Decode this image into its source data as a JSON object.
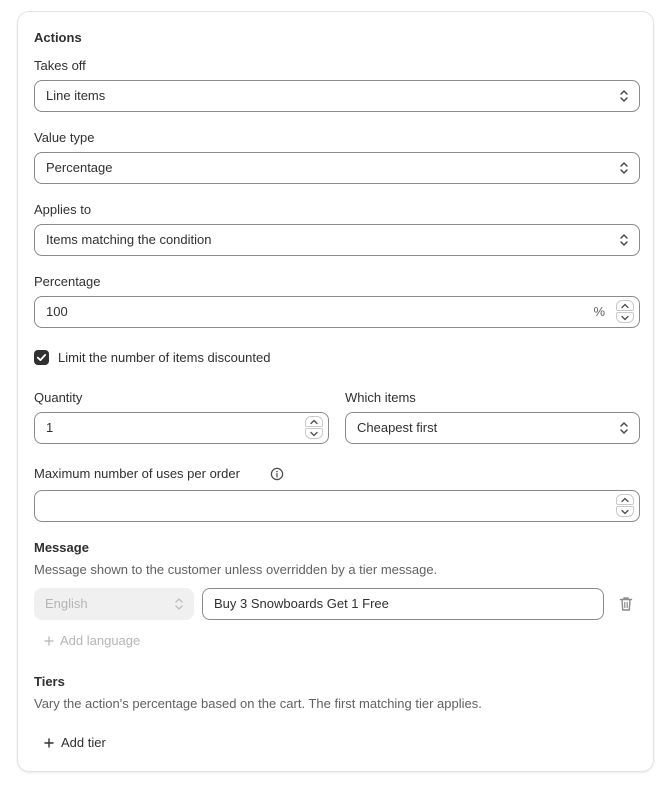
{
  "actions": {
    "title": "Actions",
    "takes_off": {
      "label": "Takes off",
      "value": "Line items"
    },
    "value_type": {
      "label": "Value type",
      "value": "Percentage"
    },
    "applies_to": {
      "label": "Applies to",
      "value": "Items matching the condition"
    },
    "percentage": {
      "label": "Percentage",
      "value": "100",
      "suffix": "%"
    },
    "limit_checkbox": {
      "label": "Limit the number of items discounted",
      "checked": true
    },
    "quantity": {
      "label": "Quantity",
      "value": "1"
    },
    "which_items": {
      "label": "Which items",
      "value": "Cheapest first"
    },
    "max_uses": {
      "label": "Maximum number of uses per order",
      "value": ""
    }
  },
  "message": {
    "title": "Message",
    "help": "Message shown to the customer unless overridden by a tier message.",
    "language": "English",
    "text": "Buy 3 Snowboards Get 1 Free",
    "add_language": "Add language"
  },
  "tiers": {
    "title": "Tiers",
    "help": "Vary the action's percentage based on the cart. The first matching tier applies.",
    "add_tier": "Add tier"
  }
}
